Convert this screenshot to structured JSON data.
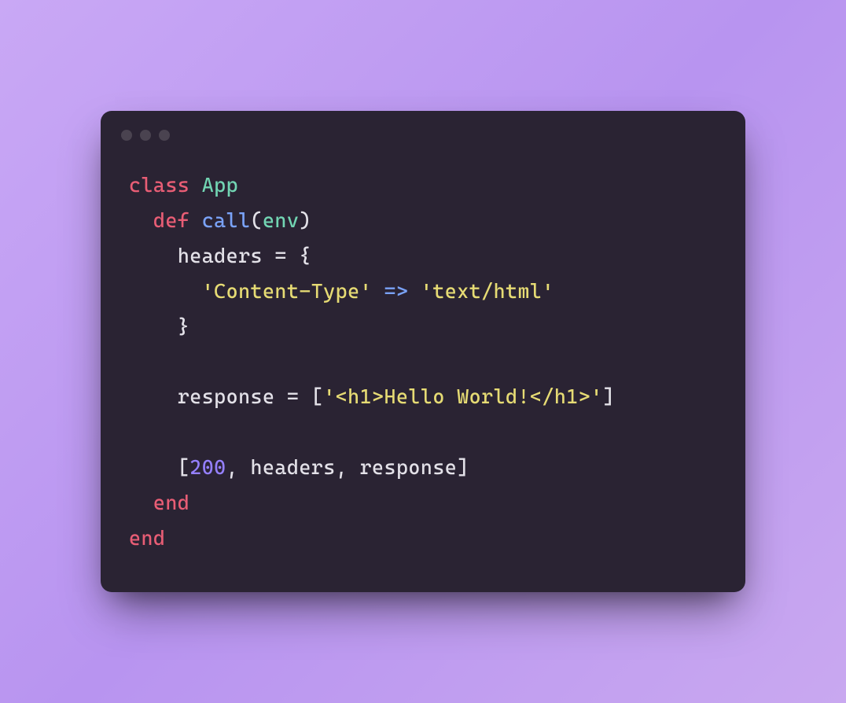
{
  "code": {
    "line1": {
      "kw": "class",
      "cls": "App"
    },
    "line2": {
      "kw": "def",
      "fn": "call",
      "paren_open": "(",
      "param": "env",
      "paren_close": ")"
    },
    "line3": {
      "var": "headers",
      "eq": " = ",
      "brace": "{"
    },
    "line4": {
      "key": "'Content-Type'",
      "arrow": " => ",
      "val": "'text/html'"
    },
    "line5": {
      "brace": "}"
    },
    "line6": {
      "var": "response",
      "eq": " = ",
      "bracket_open": "[",
      "str": "'<h1>Hello World!</h1>'",
      "bracket_close": "]"
    },
    "line7": {
      "bracket_open": "[",
      "num": "200",
      "comma1": ", ",
      "v1": "headers",
      "comma2": ", ",
      "v2": "response",
      "bracket_close": "]"
    },
    "line8": {
      "kw": "end"
    },
    "line9": {
      "kw": "end"
    }
  }
}
